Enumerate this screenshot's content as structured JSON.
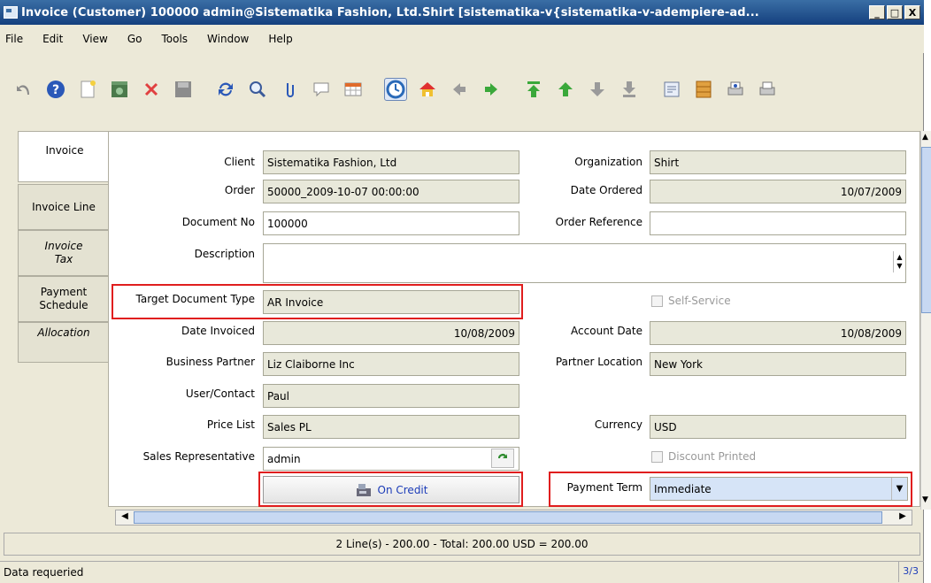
{
  "window": {
    "title": "Invoice (Customer)  100000  admin@Sistematika Fashion, Ltd.Shirt [sistematika-v{sistematika-v-adempiere-ad...",
    "min_btn": "_",
    "max_btn": "□",
    "close_btn": "X"
  },
  "menu": [
    "File",
    "Edit",
    "View",
    "Go",
    "Tools",
    "Window",
    "Help"
  ],
  "toolbar_icons": [
    "undo-icon",
    "help-icon",
    "new-record-icon",
    "save-archive-icon",
    "delete-icon",
    "save-icon",
    "refresh-icon",
    "find-icon",
    "attachment-icon",
    "chat-icon",
    "grid-toggle-icon",
    "history-icon",
    "home-icon",
    "previous-icon",
    "next-icon",
    "first-record-icon",
    "previous-record-icon",
    "next-record-icon",
    "last-record-icon",
    "report-icon",
    "archive-icon",
    "print-preview-icon",
    "print-icon"
  ],
  "tabs": [
    {
      "label": "Invoice",
      "selected": true,
      "italic": false
    },
    {
      "label": "Invoice Line",
      "selected": false,
      "italic": false
    },
    {
      "label": "Invoice Tax",
      "selected": false,
      "italic": true
    },
    {
      "label": "Payment Schedule",
      "selected": false,
      "italic": false
    },
    {
      "label": "Allocation",
      "selected": false,
      "italic": true
    }
  ],
  "form": {
    "client_label": "Client",
    "client_value": "Sistematika Fashion, Ltd",
    "organization_label": "Organization",
    "organization_value": "Shirt",
    "order_label": "Order",
    "order_value": "50000_2009-10-07 00:00:00",
    "date_ordered_label": "Date Ordered",
    "date_ordered_value": "10/07/2009",
    "document_no_label": "Document No",
    "document_no_value": "100000",
    "order_reference_label": "Order Reference",
    "order_reference_value": "",
    "description_label": "Description",
    "description_value": "",
    "target_doc_type_label": "Target Document Type",
    "target_doc_type_value": "AR Invoice",
    "self_service_label": "Self-Service",
    "date_invoiced_label": "Date Invoiced",
    "date_invoiced_value": "10/08/2009",
    "account_date_label": "Account Date",
    "account_date_value": "10/08/2009",
    "business_partner_label": "Business Partner",
    "business_partner_value": "Liz Claiborne Inc",
    "partner_location_label": "Partner Location",
    "partner_location_value": "New York",
    "user_contact_label": "User/Contact",
    "user_contact_value": "Paul",
    "price_list_label": "Price List",
    "price_list_value": "Sales PL",
    "currency_label": "Currency",
    "currency_value": "USD",
    "sales_rep_label": "Sales Representative",
    "sales_rep_value": "admin",
    "discount_printed_label": "Discount Printed",
    "on_credit_button": "On Credit",
    "payment_term_label": "Payment Term",
    "payment_term_value": "Immediate"
  },
  "summary": "2 Line(s) - 200.00 -  Total: 200.00  USD  =  200.00",
  "status": {
    "message": "Data requeried",
    "record": "3/3"
  },
  "colors": {
    "highlight": "#e01e1e",
    "title_bar": "#14407e",
    "payment_term_bg": "#d6e4f7"
  }
}
